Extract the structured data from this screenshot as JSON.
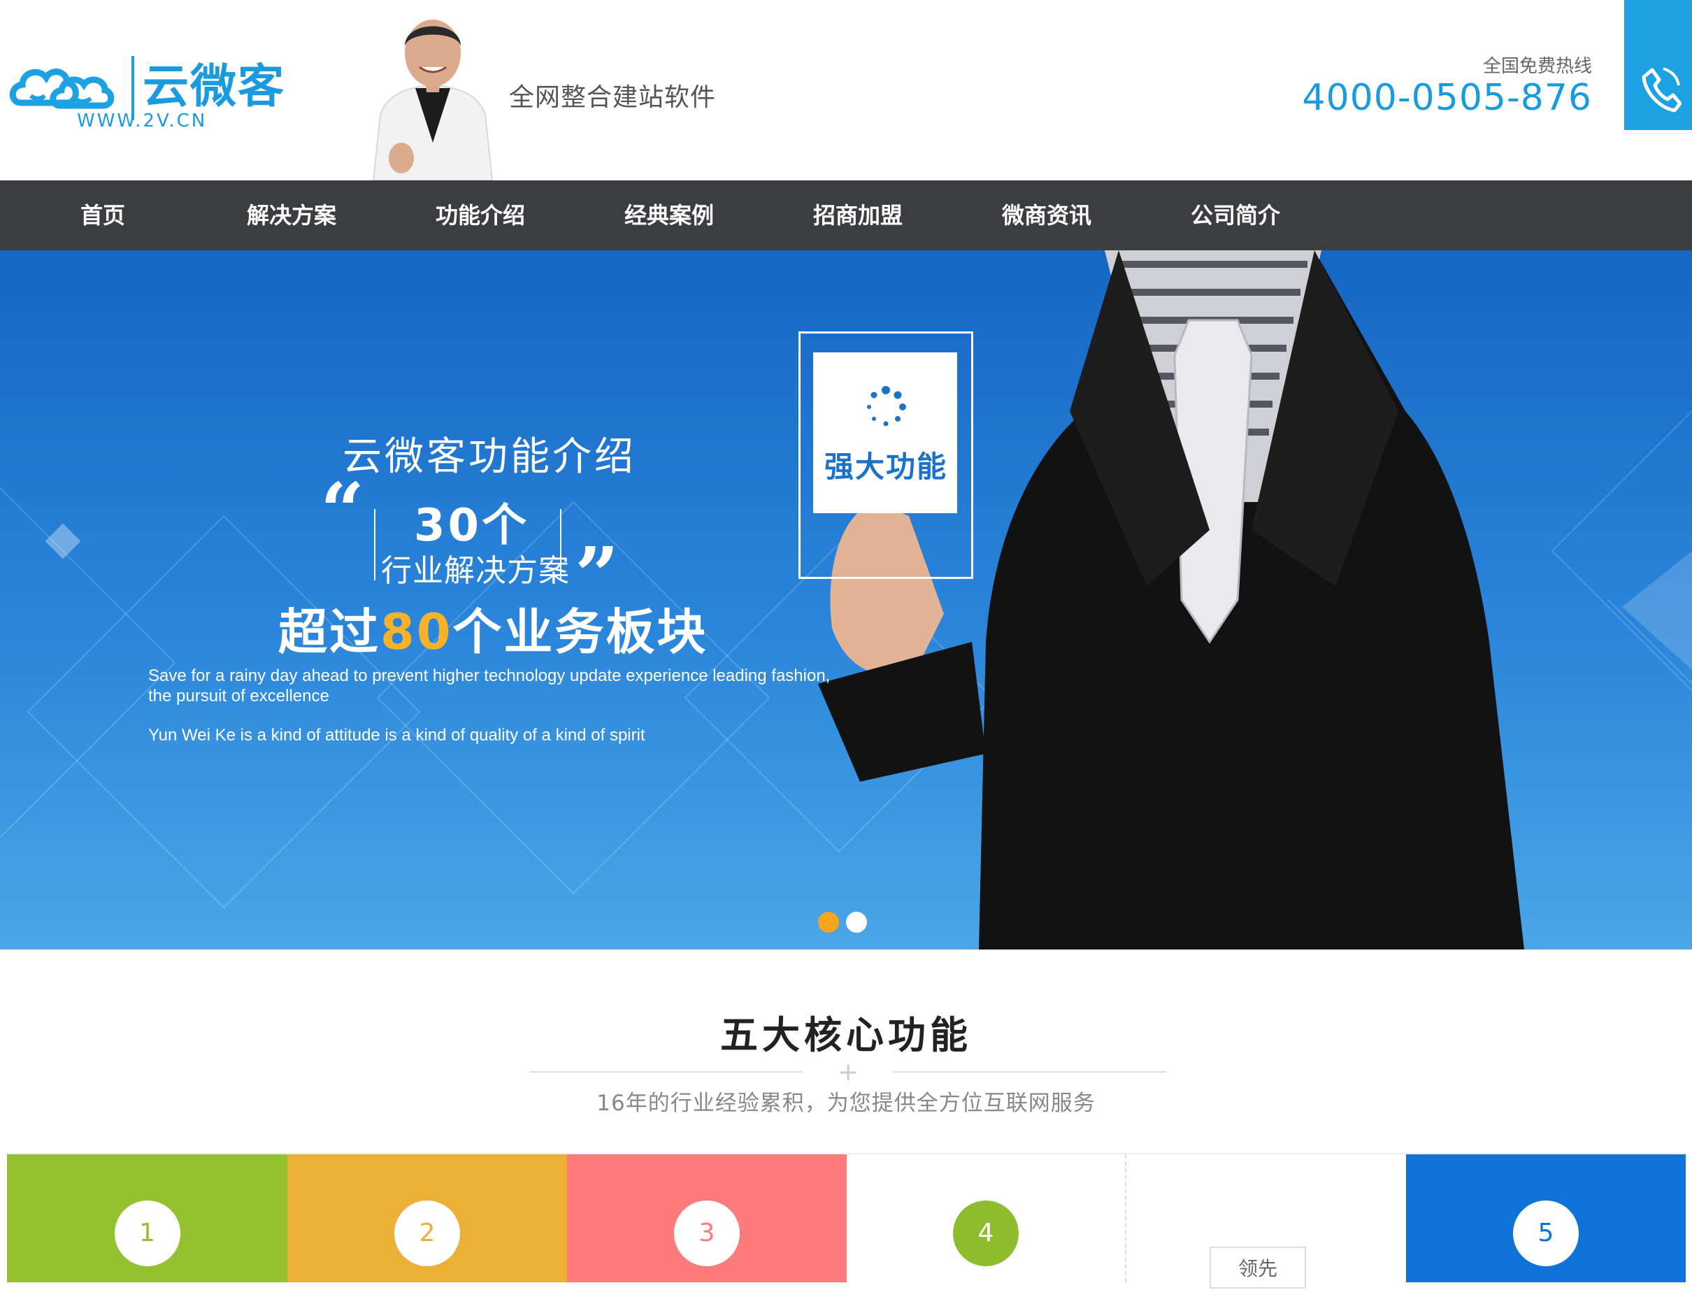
{
  "header": {
    "logo_text": "云微客",
    "logo_url": "WWW.2V.CN",
    "slogan": "全网整合建站软件",
    "hotline_label": "全国免费热线",
    "hotline_number": "4000-0505-876",
    "phone_icon": "phone-icon"
  },
  "nav": {
    "items": [
      {
        "label": "首页"
      },
      {
        "label": "解决方案"
      },
      {
        "label": "功能介绍"
      },
      {
        "label": "经典案例"
      },
      {
        "label": "招商加盟"
      },
      {
        "label": "微商资讯"
      },
      {
        "label": "公司简介"
      }
    ]
  },
  "banner": {
    "title": "云微客功能介绍",
    "count_main": "30个",
    "count_sub": "行业解决方案",
    "over_prefix": "超过",
    "over_number": "80",
    "over_suffix": "个业务板块",
    "en_line1": "Save for a rainy day ahead to prevent higher technology update experience leading fashion, the pursuit of excellence",
    "en_line2": "Yun Wei Ke is a kind of attitude is a kind of quality of a kind of spirit",
    "card_label": "强大功能",
    "slides_total": 2,
    "slide_active": 1
  },
  "section": {
    "title": "五大核心功能",
    "subtitle": "16年的行业经验累积，为您提供全方位互联网服务"
  },
  "cards": [
    {
      "num": "1",
      "bg": "#94c12f",
      "color": "#94c12f"
    },
    {
      "num": "2",
      "bg": "#ecb037",
      "color": "#ecb037"
    },
    {
      "num": "3",
      "bg": "#fe7b7b",
      "color": "#fe7b7b"
    },
    {
      "num": "4",
      "bg": "#ffffff",
      "color": "#ffffff",
      "circle": "#8dbd2e"
    },
    {
      "num": "",
      "bg": "#ffffff",
      "tag": "领先"
    },
    {
      "num": "5",
      "bg": "#0f72d6",
      "color": "#0f72d6"
    }
  ],
  "colors": {
    "brand_blue": "#1a9be0",
    "nav_bg": "#3c3d40",
    "highlight_orange": "#f5b22a"
  }
}
